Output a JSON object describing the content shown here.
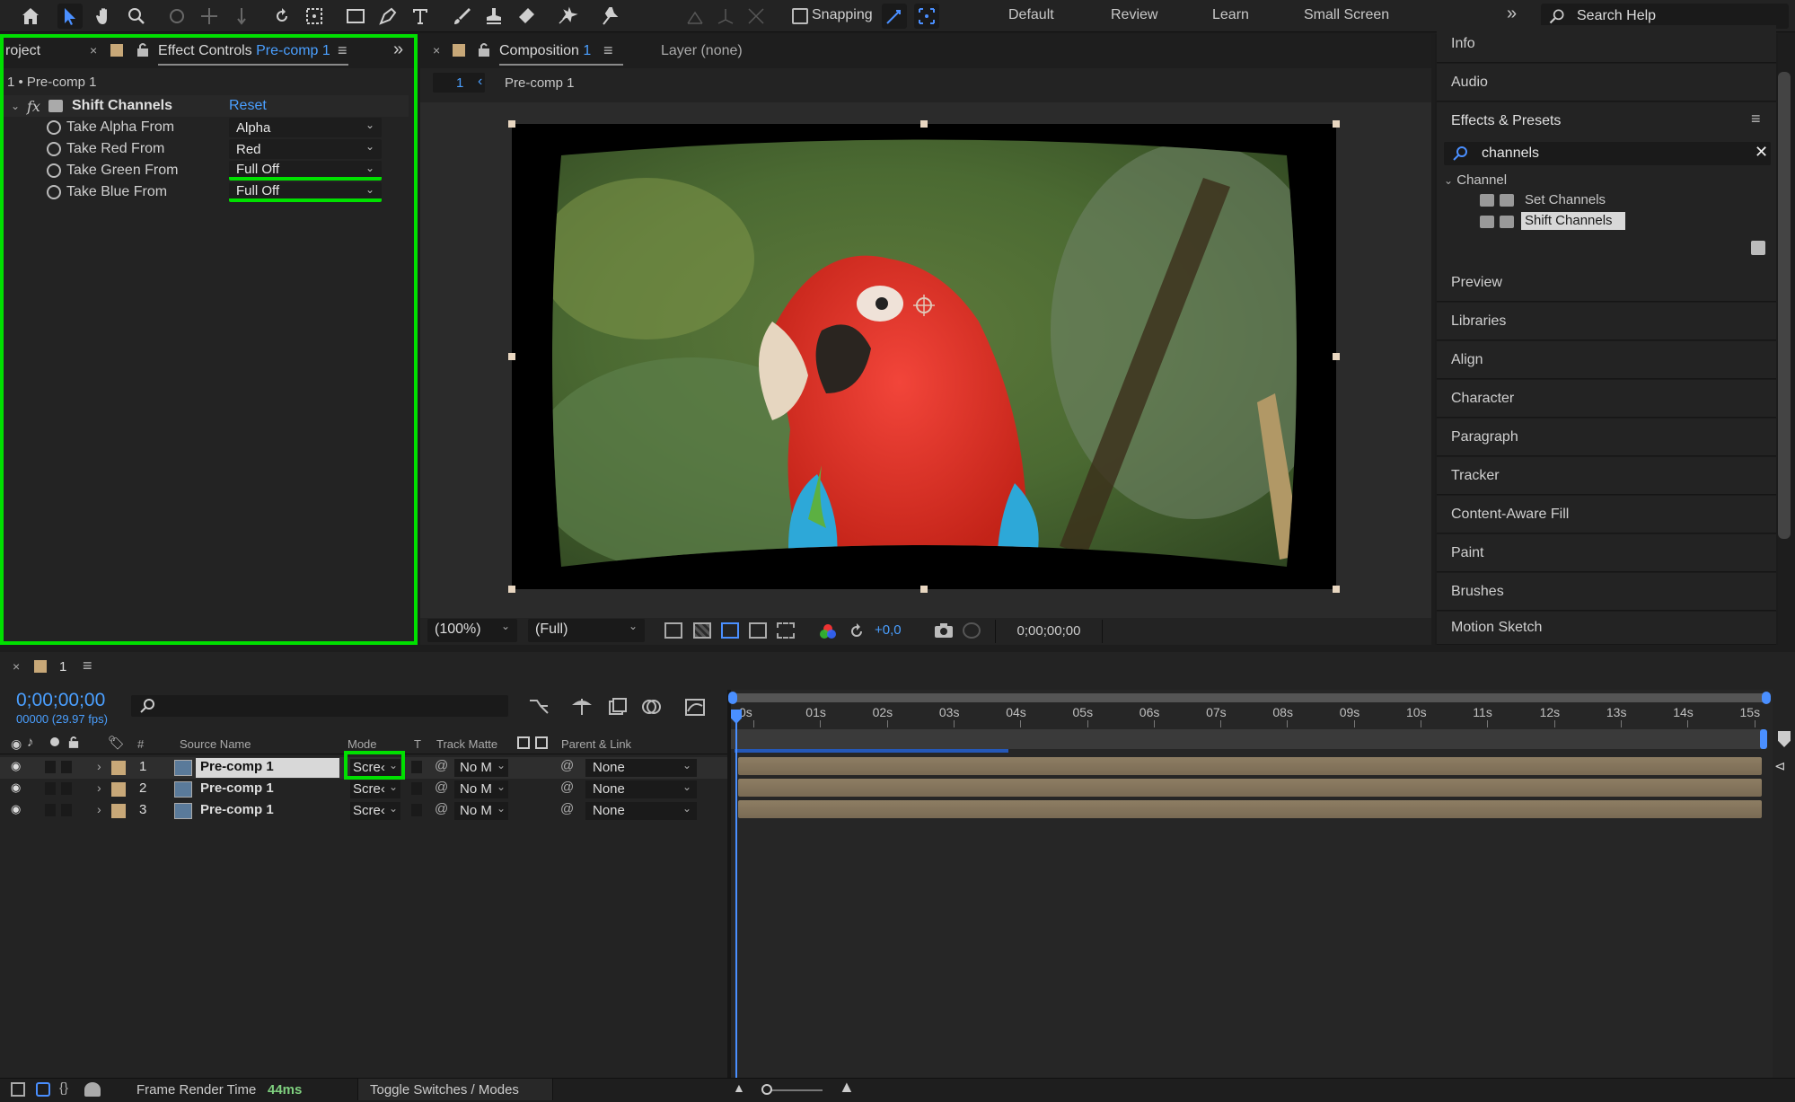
{
  "toolbar": {
    "snapping_label": "Snapping",
    "workspaces": [
      "Default",
      "Review",
      "Learn",
      "Small Screen"
    ],
    "overflow": "»",
    "search_help": "Search Help"
  },
  "left_panel": {
    "project_tab": "roject",
    "ec_tab_title": "Effect Controls",
    "ec_tab_comp": "Pre-comp 1",
    "layer_path": "1 • Pre-comp 1",
    "fx_label": "fx",
    "effect_name": "Shift Channels",
    "reset_label": "Reset",
    "properties": [
      {
        "label": "Take Alpha From",
        "value": "Alpha"
      },
      {
        "label": "Take Red From",
        "value": "Red"
      },
      {
        "label": "Take Green From",
        "value": "Full Off"
      },
      {
        "label": "Take Blue From",
        "value": "Full Off"
      }
    ]
  },
  "composition": {
    "tab_title": "Composition",
    "tab_num": "1",
    "layer_tab": "Layer (none)",
    "breadcrumb_num": "1",
    "breadcrumb_name": "Pre-comp 1",
    "zoom": "(100%)",
    "resolution": "(Full)",
    "exposure": "+0,0",
    "timecode": "0;00;00;00"
  },
  "right_panel": {
    "top_items": [
      "Info",
      "Audio"
    ],
    "effects_title": "Effects & Presets",
    "search_value": "channels",
    "category": "Channel",
    "results": [
      "Set Channels",
      "Shift Channels"
    ],
    "bottom_items": [
      "Preview",
      "Libraries",
      "Align",
      "Character",
      "Paragraph",
      "Tracker",
      "Content-Aware Fill",
      "Paint",
      "Brushes",
      "Motion Sketch"
    ]
  },
  "timeline": {
    "tab_num": "1",
    "timecode": "0;00;00;00",
    "fps": "00000 (29.97 fps)",
    "headers": {
      "hash": "#",
      "source": "Source Name",
      "mode": "Mode",
      "t": "T",
      "track_matte": "Track Matte",
      "parent": "Parent & Link"
    },
    "layers": [
      {
        "num": "1",
        "name": "Pre-comp 1",
        "mode": "Scre‹",
        "matte": "No M",
        "parent": "None"
      },
      {
        "num": "2",
        "name": "Pre-comp 1",
        "mode": "Scre‹",
        "matte": "No M",
        "parent": "None"
      },
      {
        "num": "3",
        "name": "Pre-comp 1",
        "mode": "Scre‹",
        "matte": "No M",
        "parent": "None"
      }
    ],
    "ruler": [
      "0s",
      "01s",
      "02s",
      "03s",
      "04s",
      "05s",
      "06s",
      "07s",
      "08s",
      "09s",
      "10s",
      "11s",
      "12s",
      "13s",
      "14s",
      "15s"
    ]
  },
  "statusbar": {
    "frame_render_label": "Frame Render Time",
    "frame_render_value": "44ms",
    "toggle_label": "Toggle Switches / Modes"
  },
  "colors": {
    "accent": "#4a8fff",
    "highlight": "#00e000",
    "bar": "#8d7d63",
    "render_time": "#7fd07f"
  }
}
